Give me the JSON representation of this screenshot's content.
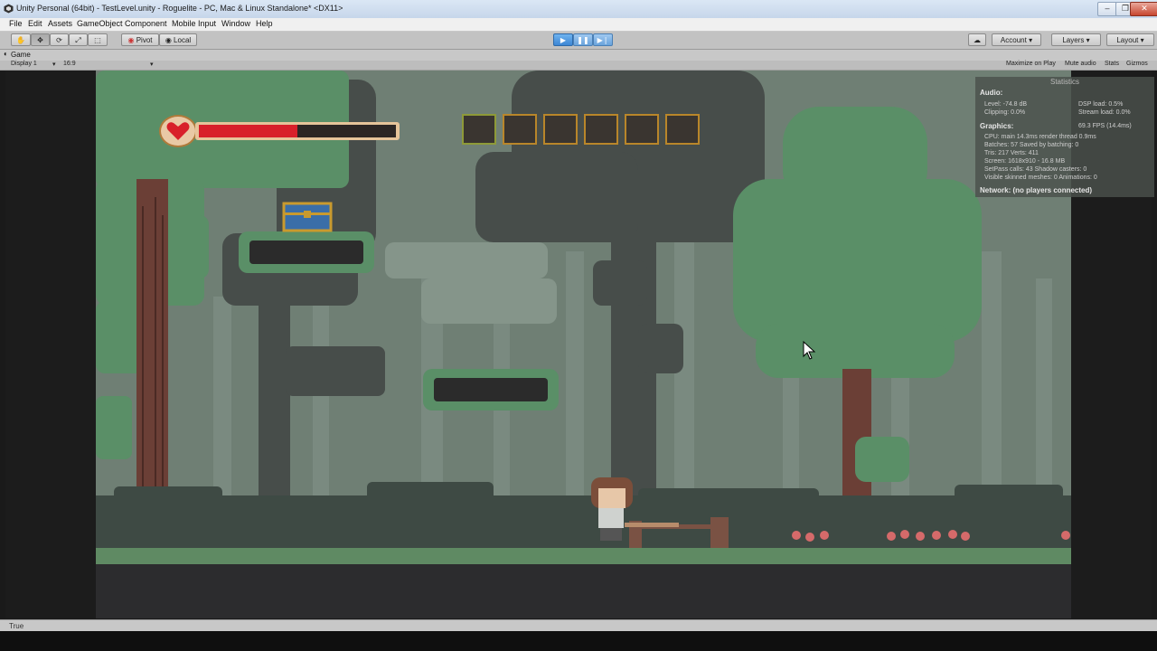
{
  "window": {
    "title": "Unity Personal (64bit) - TestLevel.unity - Roguelite - PC, Mac & Linux Standalone* <DX11>",
    "controls": [
      "–",
      "❐",
      "✕"
    ]
  },
  "menu": [
    "File",
    "Edit",
    "Assets",
    "GameObject",
    "Component",
    "Mobile Input",
    "Window",
    "Help"
  ],
  "toolbar": {
    "pivot": "Pivot",
    "local": "Local",
    "account": "Account",
    "layers": "Layers",
    "layout": "Layout"
  },
  "game_tab": {
    "label": "Game",
    "display": "Display 1",
    "aspect": "16:9",
    "maximize": "Maximize on Play",
    "mute": "Mute audio",
    "stats": "Stats",
    "gizmos": "Gizmos"
  },
  "stats": {
    "header": "Statistics",
    "audio_title": "Audio:",
    "level": "Level: -74.8 dB",
    "clipping": "Clipping: 0.0%",
    "dsp": "DSP load: 0.5%",
    "stream": "Stream load: 0.0%",
    "graphics_title": "Graphics:",
    "fps": "69.3 FPS (14.4ms)",
    "cpu": "CPU: main 14.3ms  render thread 0.9ms",
    "batches": "Batches: 57     Saved by batching: 0",
    "tris": "Tris: 217  Verts: 411",
    "screen": "Screen: 1618x910 - 16.8 MB",
    "setpass": "SetPass calls: 43     Shadow casters: 0",
    "skinned": "Visible skinned meshes: 0  Animations: 0",
    "network": "Network: (no players connected)"
  },
  "hud": {
    "health_fraction": 0.5,
    "inventory_slots": 6,
    "selected_slot": 0
  },
  "status": {
    "text": "True"
  },
  "colors": {
    "play_blue": "#3d86d4",
    "health_red": "#d8202a",
    "slot_border": "#b9862a",
    "forest_bg": "#6f7f74"
  }
}
